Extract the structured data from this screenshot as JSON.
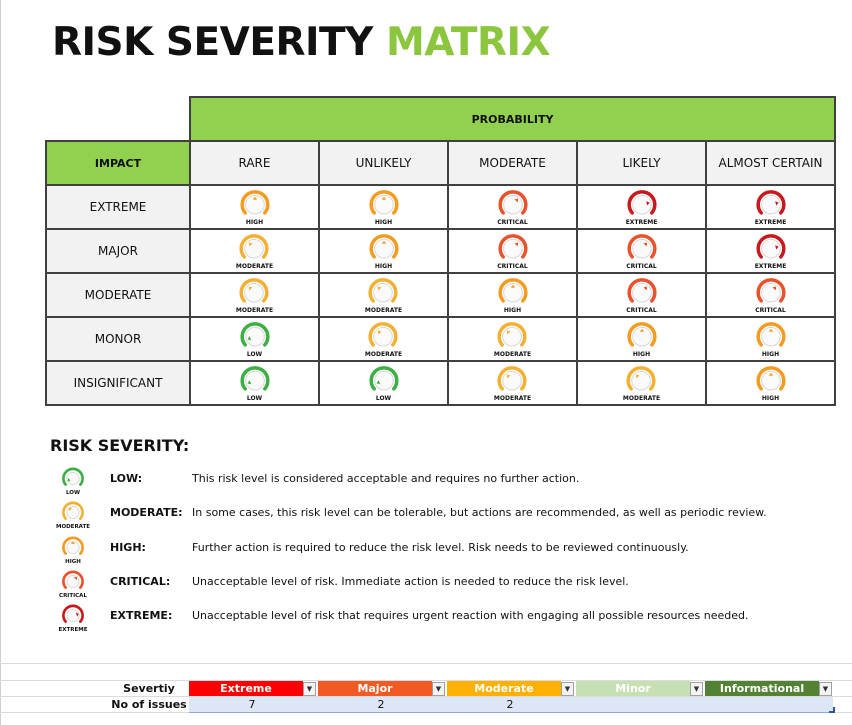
{
  "title": {
    "part1": "RISK SEVERITY",
    "part2": "MATRIX"
  },
  "colors": {
    "accent_green": "#92d050",
    "title_green": "#8cc63f",
    "low": "#3cb043",
    "moderate": "#f4b032",
    "high": "#f39c1f",
    "critical": "#e8532b",
    "extreme": "#c8191e"
  },
  "matrix": {
    "probability_label": "PROBABILITY",
    "impact_label": "IMPACT",
    "columns": [
      "RARE",
      "UNLIKELY",
      "MODERATE",
      "LIKELY",
      "ALMOST CERTAIN"
    ],
    "rows": [
      {
        "label": "EXTREME",
        "cells": [
          "HIGH",
          "HIGH",
          "CRITICAL",
          "EXTREME",
          "EXTREME"
        ]
      },
      {
        "label": "MAJOR",
        "cells": [
          "MODERATE",
          "HIGH",
          "CRITICAL",
          "CRITICAL",
          "EXTREME"
        ]
      },
      {
        "label": "MODERATE",
        "cells": [
          "MODERATE",
          "MODERATE",
          "HIGH",
          "CRITICAL",
          "CRITICAL"
        ]
      },
      {
        "label": "MONOR",
        "cells": [
          "LOW",
          "MODERATE",
          "MODERATE",
          "HIGH",
          "HIGH"
        ]
      },
      {
        "label": "INSIGNIFICANT",
        "cells": [
          "LOW",
          "LOW",
          "MODERATE",
          "MODERATE",
          "HIGH"
        ]
      }
    ]
  },
  "legend": {
    "title": "RISK SEVERITY:",
    "items": [
      {
        "icon_label": "LOW",
        "name": "LOW:",
        "desc": "This risk level is considered acceptable and requires no further action."
      },
      {
        "icon_label": "MODERATE",
        "name": "MODERATE:",
        "desc": "In some cases, this risk level can be tolerable, but actions are recommended, as well as periodic review."
      },
      {
        "icon_label": "HIGH",
        "name": "HIGH:",
        "desc": "Further action is required to reduce the risk level. Risk needs to be reviewed continuously."
      },
      {
        "icon_label": "CRITICAL",
        "name": "CRITICAL:",
        "desc": "Unacceptable level of risk. Immediate action is needed to reduce the risk level."
      },
      {
        "icon_label": "EXTREME",
        "name": "EXTREME:",
        "desc": "Unacceptable level of risk that requires urgent reaction with engaging all possible resources needed."
      }
    ]
  },
  "summary": {
    "severity_label": "Severtiy",
    "issues_label": "No of issues",
    "levels": [
      {
        "name": "Extreme",
        "color": "#ff0000",
        "count": "7"
      },
      {
        "name": "Major",
        "color": "#f15a24",
        "count": "2"
      },
      {
        "name": "Moderate",
        "color": "#ffb000",
        "count": "2"
      },
      {
        "name": "Minor",
        "color": "#c6e0b4",
        "count": ""
      },
      {
        "name": "Informational",
        "color": "#548235",
        "count": ""
      }
    ]
  }
}
